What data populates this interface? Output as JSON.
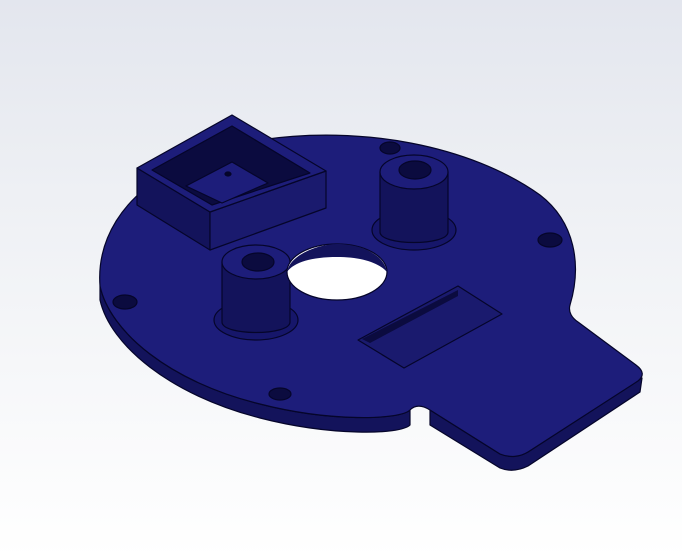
{
  "viewport": {
    "background_top": "#e3e6ee",
    "background_bottom": "#ffffff"
  },
  "part": {
    "top_color": "#1d1d7a",
    "side_color": "#13135b",
    "dark_color": "#0b0b3f",
    "edge_color": "#05052a",
    "hole_fill": "#ffffff",
    "features": [
      "base-plate",
      "tab",
      "square-pocket-box",
      "standoff-left",
      "standoff-right",
      "center-hole",
      "rect-recess",
      "mounting-holes"
    ]
  }
}
